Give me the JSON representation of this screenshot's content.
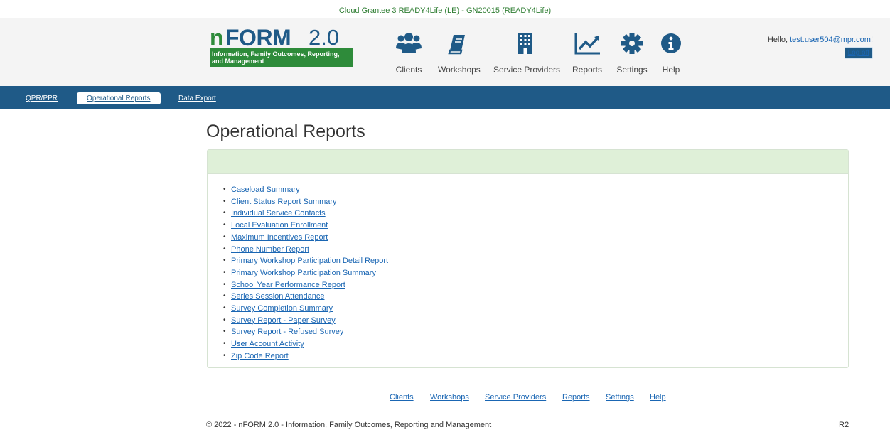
{
  "grantee": "Cloud Grantee 3 READY4Life (LE) - GN20015 (READY4Life)",
  "logo": {
    "n": "n",
    "form": "FORM",
    "version": "2.0",
    "tagline": "Information, Family Outcomes, Reporting, and Management"
  },
  "nav": [
    {
      "label": "Clients",
      "icon": "clients-icon"
    },
    {
      "label": "Workshops",
      "icon": "workshops-icon"
    },
    {
      "label": "Service Providers",
      "icon": "service-providers-icon"
    },
    {
      "label": "Reports",
      "icon": "reports-icon"
    },
    {
      "label": "Settings",
      "icon": "settings-icon"
    },
    {
      "label": "Help",
      "icon": "help-icon"
    }
  ],
  "user": {
    "greeting": "Hello,",
    "email": "test.user504@mpr.com!",
    "logoff": "Log off"
  },
  "subnav": {
    "items": [
      "QPR/PPR",
      "Operational Reports",
      "Data Export"
    ],
    "active": "Operational Reports"
  },
  "page_title": "Operational Reports",
  "reports": [
    "Caseload Summary",
    "Client Status Report Summary",
    "Individual Service Contacts",
    "Local Evaluation Enrollment",
    "Maximum Incentives Report",
    "Phone Number Report",
    "Primary Workshop Participation Detail Report",
    "Primary Workshop Participation Summary",
    "School Year Performance Report",
    "Series Session Attendance",
    "Survey Completion Summary",
    "Survey Report - Paper Survey",
    "Survey Report - Refused Survey",
    "User Account Activity",
    "Zip Code Report"
  ],
  "footer": {
    "links": [
      "Clients",
      "Workshops",
      "Service Providers",
      "Reports",
      "Settings",
      "Help"
    ],
    "copyright": "© 2022 - nFORM 2.0 - Information, Family Outcomes, Reporting and Management",
    "release": "R2"
  },
  "colors": {
    "brand_blue": "#1f5a87",
    "brand_green": "#2e8b3a",
    "panel_header": "#dff0d8",
    "link": "#1a66b3"
  }
}
